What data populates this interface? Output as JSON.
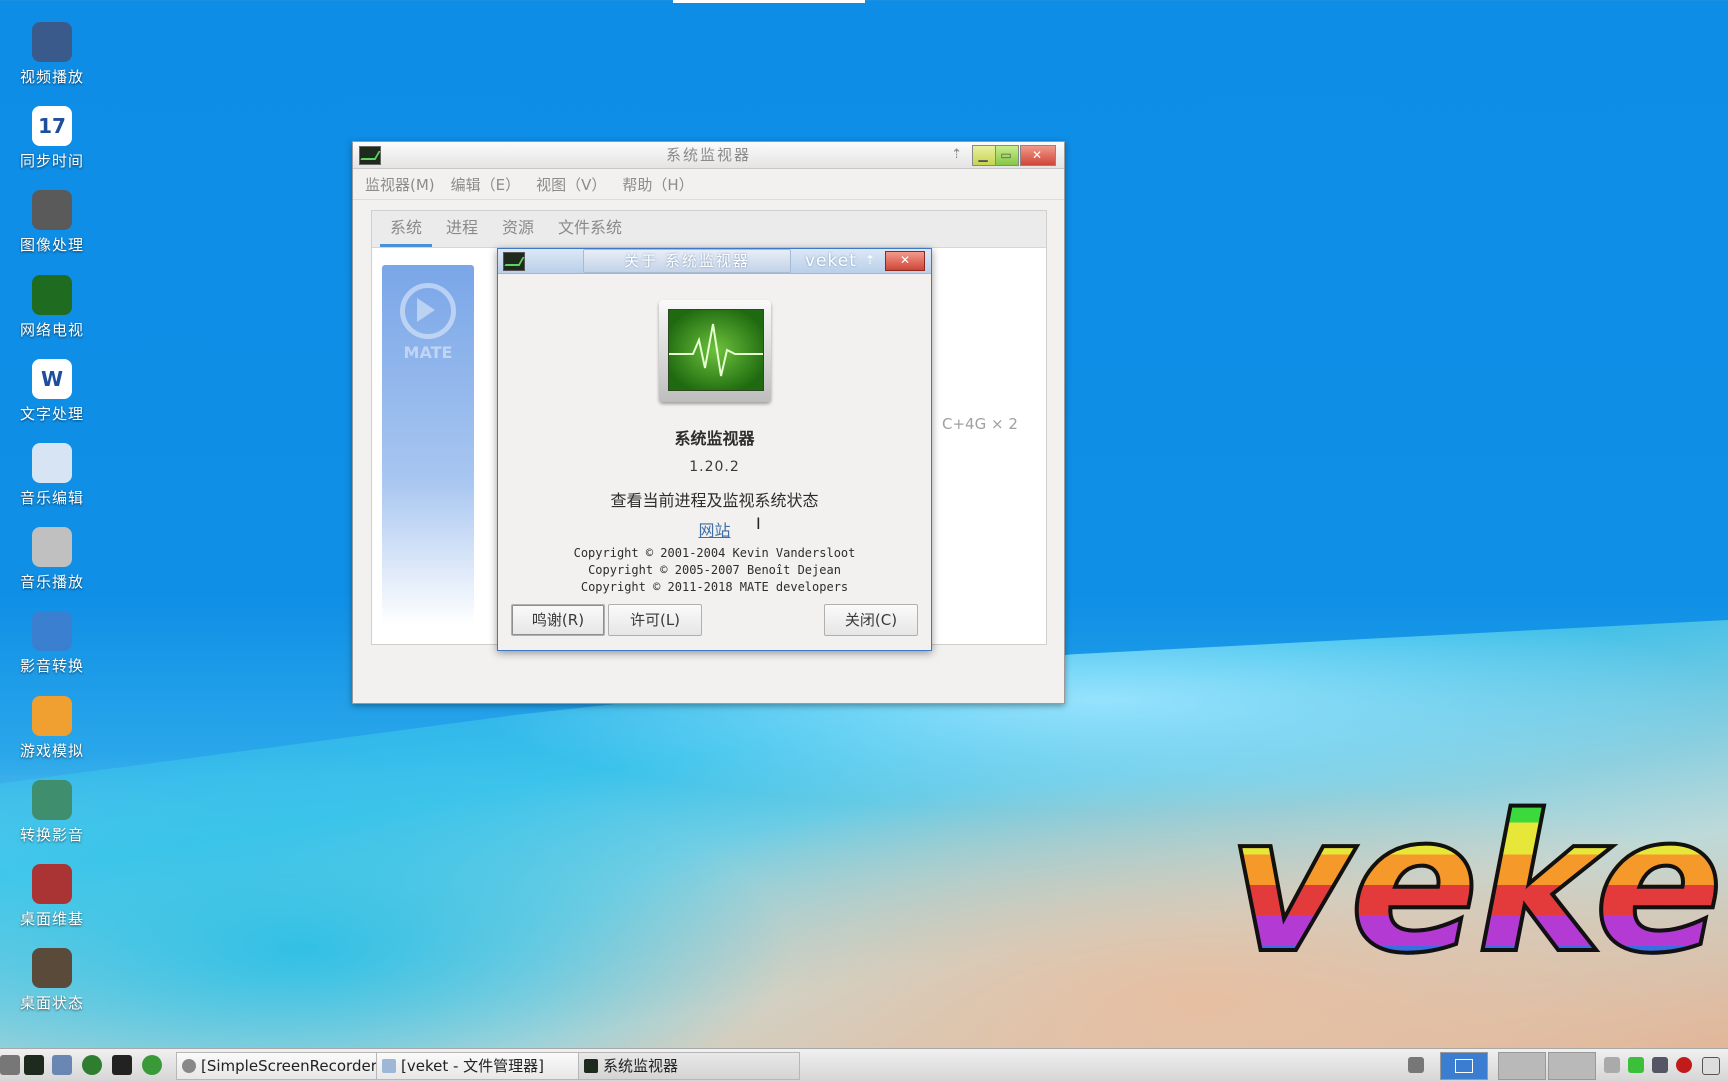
{
  "desktop": {
    "icons": [
      {
        "label": "视频播放",
        "icon": "video-player-icon"
      },
      {
        "label": "同步时间",
        "icon": "calendar-icon",
        "badge": "17"
      },
      {
        "label": "图像处理",
        "icon": "gimp-icon"
      },
      {
        "label": "网络电视",
        "icon": "play-triangle-icon"
      },
      {
        "label": "文字处理",
        "icon": "word-processor-icon",
        "badge": "W"
      },
      {
        "label": "音乐编辑",
        "icon": "music-editor-icon"
      },
      {
        "label": "音乐播放",
        "icon": "speaker-icon"
      },
      {
        "label": "影音转换",
        "icon": "media-convert-icon"
      },
      {
        "label": "游戏模拟",
        "icon": "game-emulator-icon"
      },
      {
        "label": "转换影音",
        "icon": "convert-media-icon"
      },
      {
        "label": "桌面维基",
        "icon": "desktop-wiki-icon"
      },
      {
        "label": "桌面状态",
        "icon": "desktop-status-icon"
      }
    ],
    "wallpaper_logo": "veke"
  },
  "main_window": {
    "title": "系统监视器",
    "menu": [
      "监视器(M)",
      "编辑（E）",
      "视图（V）",
      "帮助（H）"
    ],
    "tabs": [
      "系统",
      "进程",
      "资源",
      "文件系统"
    ],
    "active_tab": "系统",
    "side_logo_text": "MATE",
    "partial_text": "C+4G × 2"
  },
  "about_dialog": {
    "title": "关于 系统监视器",
    "title_overlay": "veket",
    "app_name": "系统监视器",
    "version": "1.20.2",
    "description": "查看当前进程及监视系统状态",
    "website_label": "网站",
    "copyright": [
      "Copyright © 2001-2004 Kevin Vandersloot",
      "Copyright © 2005-2007 Benoît Dejean",
      "Copyright © 2011-2018 MATE developers"
    ],
    "buttons": {
      "credits": "鸣谢(R)",
      "license": "许可(L)",
      "close": "关闭(C)"
    }
  },
  "taskbar": {
    "tasks": [
      {
        "label": "[SimpleScreenRecorder]"
      },
      {
        "label": "[veket - 文件管理器]"
      },
      {
        "label": "系统监视器"
      }
    ]
  }
}
